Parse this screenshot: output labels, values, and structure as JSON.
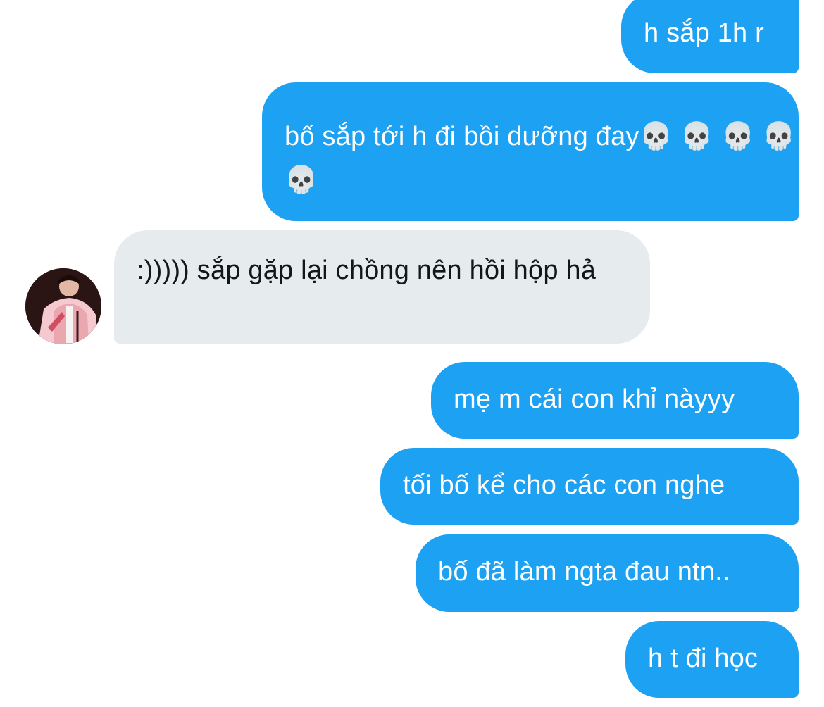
{
  "conversation": {
    "messages": [
      {
        "direction": "outgoing",
        "text": "h sắp 1h r"
      },
      {
        "direction": "outgoing",
        "text": "bố sắp tới h đi bồi dưỡng đay",
        "emoji": "💀 💀 💀 💀 💀"
      },
      {
        "direction": "incoming",
        "text": ":))))) sắp gặp lại chồng nên hồi hộp hả"
      },
      {
        "direction": "outgoing",
        "text": "mẹ m cái con khỉ nàyyy"
      },
      {
        "direction": "outgoing",
        "text": "tối bố kể cho các con nghe"
      },
      {
        "direction": "outgoing",
        "text": "bố đã làm ngta đau ntn.."
      },
      {
        "direction": "outgoing",
        "text": "h t đi học"
      }
    ]
  },
  "colors": {
    "outgoing_bubble": "#1da1f2",
    "incoming_bubble": "#e6ebee",
    "incoming_text": "#14171a"
  },
  "icons": {
    "avatar": "profile-photo"
  }
}
